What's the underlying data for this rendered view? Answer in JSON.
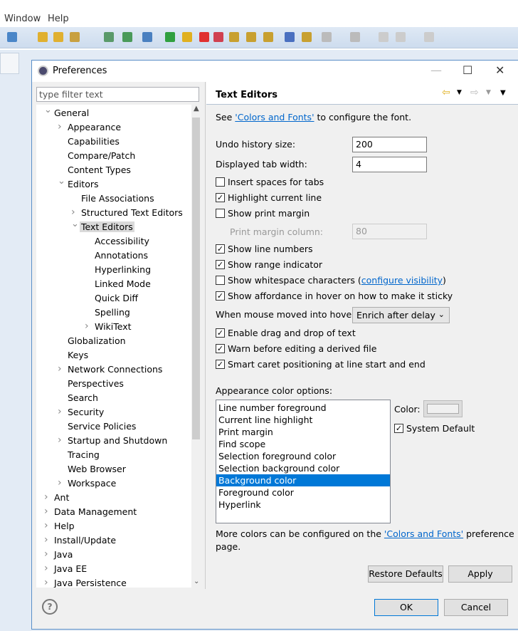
{
  "menubar": {
    "items": [
      "Window",
      "Help"
    ]
  },
  "dialog": {
    "title": "Preferences"
  },
  "filter": {
    "placeholder": "type filter text"
  },
  "tree": [
    {
      "label": "General",
      "level": 0,
      "arrow": "expanded"
    },
    {
      "label": "Appearance",
      "level": 1,
      "arrow": "collapsed"
    },
    {
      "label": "Capabilities",
      "level": 1,
      "arrow": "none"
    },
    {
      "label": "Compare/Patch",
      "level": 1,
      "arrow": "none"
    },
    {
      "label": "Content Types",
      "level": 1,
      "arrow": "none"
    },
    {
      "label": "Editors",
      "level": 1,
      "arrow": "expanded"
    },
    {
      "label": "File Associations",
      "level": 2,
      "arrow": "none"
    },
    {
      "label": "Structured Text Editors",
      "level": 2,
      "arrow": "collapsed"
    },
    {
      "label": "Text Editors",
      "level": 2,
      "arrow": "expanded",
      "selected": true
    },
    {
      "label": "Accessibility",
      "level": 3,
      "arrow": "none"
    },
    {
      "label": "Annotations",
      "level": 3,
      "arrow": "none"
    },
    {
      "label": "Hyperlinking",
      "level": 3,
      "arrow": "none"
    },
    {
      "label": "Linked Mode",
      "level": 3,
      "arrow": "none"
    },
    {
      "label": "Quick Diff",
      "level": 3,
      "arrow": "none"
    },
    {
      "label": "Spelling",
      "level": 3,
      "arrow": "none"
    },
    {
      "label": "WikiText",
      "level": 3,
      "arrow": "collapsed"
    },
    {
      "label": "Globalization",
      "level": 1,
      "arrow": "none"
    },
    {
      "label": "Keys",
      "level": 1,
      "arrow": "none"
    },
    {
      "label": "Network Connections",
      "level": 1,
      "arrow": "collapsed"
    },
    {
      "label": "Perspectives",
      "level": 1,
      "arrow": "none"
    },
    {
      "label": "Search",
      "level": 1,
      "arrow": "none"
    },
    {
      "label": "Security",
      "level": 1,
      "arrow": "collapsed"
    },
    {
      "label": "Service Policies",
      "level": 1,
      "arrow": "none"
    },
    {
      "label": "Startup and Shutdown",
      "level": 1,
      "arrow": "collapsed"
    },
    {
      "label": "Tracing",
      "level": 1,
      "arrow": "none"
    },
    {
      "label": "Web Browser",
      "level": 1,
      "arrow": "none"
    },
    {
      "label": "Workspace",
      "level": 1,
      "arrow": "collapsed"
    },
    {
      "label": "Ant",
      "level": 0,
      "arrow": "collapsed"
    },
    {
      "label": "Data Management",
      "level": 0,
      "arrow": "collapsed"
    },
    {
      "label": "Help",
      "level": 0,
      "arrow": "collapsed"
    },
    {
      "label": "Install/Update",
      "level": 0,
      "arrow": "collapsed"
    },
    {
      "label": "Java",
      "level": 0,
      "arrow": "collapsed"
    },
    {
      "label": "Java EE",
      "level": 0,
      "arrow": "collapsed"
    },
    {
      "label": "Java Persistence",
      "level": 0,
      "arrow": "collapsed"
    }
  ],
  "page": {
    "title": "Text Editors",
    "see_prefix": "See ",
    "see_link": "'Colors and Fonts'",
    "see_suffix": " to configure the font.",
    "undo_label": "Undo history size:",
    "undo_value": "200",
    "tab_label": "Displayed tab width:",
    "tab_value": "4",
    "checks": [
      {
        "label": "Insert spaces for tabs",
        "checked": false
      },
      {
        "label": "Highlight current line",
        "checked": true
      },
      {
        "label": "Show print margin",
        "checked": false
      }
    ],
    "margin_label": "Print margin column:",
    "margin_value": "80",
    "checks2": [
      {
        "label": "Show line numbers",
        "checked": true
      },
      {
        "label": "Show range indicator",
        "checked": true
      },
      {
        "label": "Show whitespace characters (",
        "checked": false,
        "link": "configure visibility",
        "after": ")"
      },
      {
        "label": "Show affordance in hover on how to make it sticky",
        "checked": true
      }
    ],
    "hover_label": "When mouse moved into hover:",
    "hover_value": "Enrich after delay",
    "checks3": [
      {
        "label": "Enable drag and drop of text",
        "checked": true
      },
      {
        "label": "Warn before editing a derived file",
        "checked": true
      },
      {
        "label": "Smart caret positioning at line start and end",
        "checked": true
      }
    ],
    "appearance_label": "Appearance color options:",
    "color_options": [
      "Line number foreground",
      "Current line highlight",
      "Print margin",
      "Find scope",
      "Selection foreground color",
      "Selection background color",
      "Background color",
      "Foreground color",
      "Hyperlink"
    ],
    "selected_option": "Background color",
    "color_label": "Color:",
    "system_default": "System Default",
    "more_prefix": "More colors can be configured on the ",
    "more_link": "'Colors and Fonts'",
    "more_suffix": " preference page.",
    "restore": "Restore Defaults",
    "apply": "Apply"
  },
  "footer": {
    "ok": "OK",
    "cancel": "Cancel"
  },
  "colors": {
    "selection": "#0078d7",
    "link": "#0066cc",
    "border": "#5a8fc8"
  }
}
